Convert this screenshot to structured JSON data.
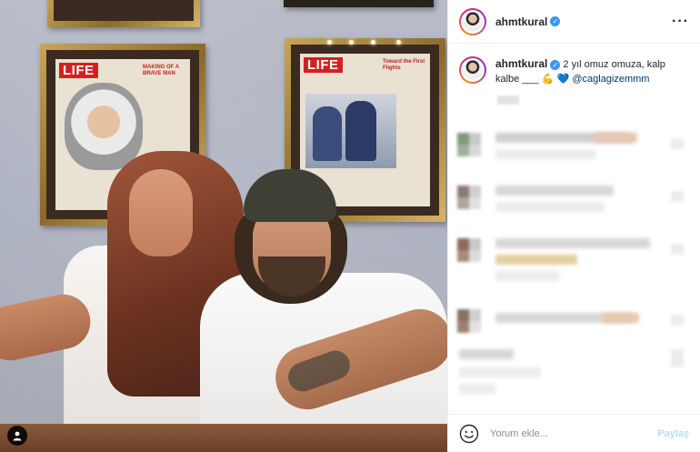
{
  "post": {
    "username": "ahmtkural",
    "verified": true,
    "caption": "2 yıl omuz omuza, kalp kalbe ___",
    "caption_mention": "@caglagizemmm",
    "photo_magazine_logo": "LIFE",
    "photo_cover_left_headline": "MAKING OF A BRAVE MAN",
    "photo_cover_right_headline": "Toward the First Flights",
    "icons": {
      "verified": "verified-badge-icon",
      "more": "more-options-icon",
      "emoji": "emoji-icon",
      "tag": "user-tag-icon",
      "caption_hand": "muscle-emoji-icon",
      "caption_heart": "blue-heart-emoji-icon"
    }
  },
  "comment_box": {
    "placeholder": "Yorum ekle...",
    "share_label": "Paylaş"
  },
  "colors": {
    "verified": "#3897f0",
    "mention": "#003569",
    "share_disabled": "#b2dffc"
  }
}
